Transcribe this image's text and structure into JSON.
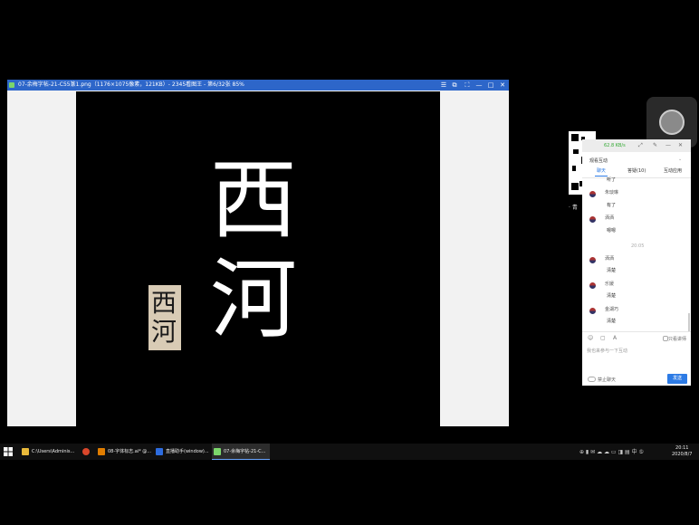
{
  "viewer": {
    "title": "07-余梅字帖-21-C55篆1.png（1176×1075像素，121KB）- 2345看图王 - 第6/32张 85%",
    "controls": [
      "☰",
      "⧉",
      "⛶",
      "—",
      "□",
      "✕"
    ],
    "big_chars": [
      "西",
      "河"
    ],
    "rubbing_chars": [
      "西",
      "河"
    ]
  },
  "qr": {
    "caption": "· 青"
  },
  "chat": {
    "signal": "62.8 KB/s",
    "title": "观看互动",
    "tabs": [
      "聊天",
      "答疑(10)",
      "互动应用"
    ],
    "messages": [
      {
        "name": "",
        "text": "听了"
      },
      {
        "name": "朱琰琳",
        "text": "有了"
      },
      {
        "name": "洒洒",
        "text": "嗯嗯"
      },
      {
        "time": "20:05"
      },
      {
        "name": "洒洒",
        "text": "清楚"
      },
      {
        "name": "乐媛",
        "text": "清楚"
      },
      {
        "name": "金湖巧",
        "text": "清楚"
      }
    ],
    "toolbar": {
      "emoji": "☺",
      "image": "▢",
      "font": "A",
      "only_teacher": "只看讲师"
    },
    "input_placeholder": "我也来参与一下互动",
    "mute_label": "禁止聊天",
    "send_label": "发送"
  },
  "taskbar": {
    "items": [
      {
        "label": "C:\\Users\\Adminis...",
        "color": "#e8b93a"
      },
      {
        "label": "",
        "color": "#d9472b"
      },
      {
        "label": "08-字体标志.ai* @...",
        "color": "#e07d00"
      },
      {
        "label": "直播助手(window)...",
        "color": "#2d6cdf"
      },
      {
        "label": "07-余梅字帖-21-C...",
        "color": "#7bd66b"
      }
    ],
    "tray": "⊕ ▮ ✉ ☁ ☁ ▭ ◨ ▤ 中 ⑤",
    "time": "20:11",
    "date": "2020/8/7"
  }
}
